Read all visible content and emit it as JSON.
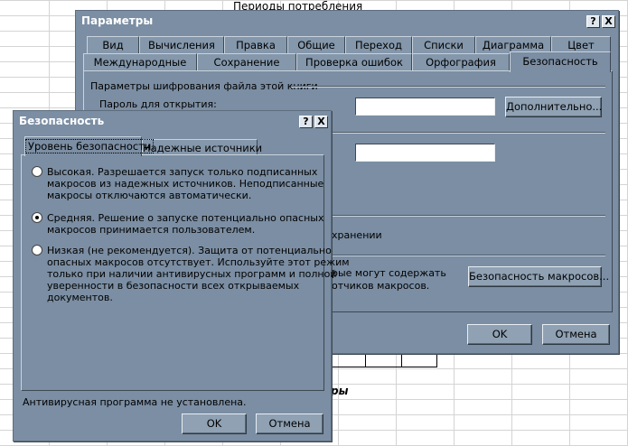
{
  "spreadsheet": {
    "header_text": "Периоды потребления",
    "bold_text": "ры"
  },
  "params_dialog": {
    "title": "Параметры",
    "help_btn": "?",
    "close_btn": "X",
    "tabs_row1": [
      "Вид",
      "Вычисления",
      "Правка",
      "Общие",
      "Переход",
      "Списки",
      "Диаграмма",
      "Цвет"
    ],
    "tabs_row2": [
      "Международные",
      "Сохранение",
      "Проверка ошибок",
      "Орфография",
      "Безопасность"
    ],
    "section_title": "Параметры шифрования файла этой книги",
    "password_open_label": "Пароль для открытия:",
    "advanced_btn": "Дополнительно...",
    "saving_fragment": "хранении",
    "macro_text_line1": "рые могут содержать",
    "macro_text_line2": "отчиков макросов.",
    "macro_security_btn": "Безопасность макросов...",
    "ok_btn": "OK",
    "cancel_btn": "Отмена"
  },
  "security_dialog": {
    "title": "Безопасность",
    "help_btn": "?",
    "close_btn": "X",
    "tab_level": "Уровень безопасности",
    "tab_trusted": "Надежные источники",
    "options": [
      {
        "lines": [
          "Высокая. Разрешается запуск только подписанных",
          "макросов из надежных источников. Неподписанные",
          "макросы отключаются автоматически."
        ],
        "selected": false
      },
      {
        "lines": [
          "Средняя. Решение о запуске потенциально опасных",
          "макросов принимается пользователем."
        ],
        "selected": true
      },
      {
        "lines": [
          "Низкая (не рекомендуется). Защита от потенциально",
          "опасных макросов отсутствует. Используйте этот режим",
          "только при наличии антивирусных программ и полной",
          "уверенности в безопасности всех открываемых",
          "документов."
        ],
        "selected": false
      }
    ],
    "antivirus_status": "Антивирусная программа не установлена.",
    "ok_btn": "OK",
    "cancel_btn": "Отмена"
  },
  "colors": {
    "dialog_bg": "#7b8ea3",
    "grid_line": "#d4d4d4"
  }
}
